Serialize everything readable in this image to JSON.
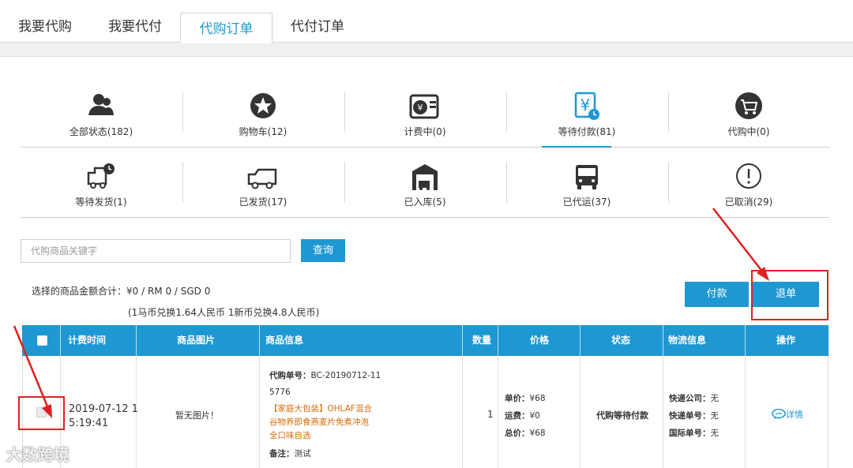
{
  "tabs": [
    "我要代购",
    "我要代付",
    "代购订单",
    "代付订单"
  ],
  "status_row1": [
    "全部状态(182)",
    "购物车(12)",
    "计费中(0)",
    "等待付款(81)",
    "代购中(0)"
  ],
  "status_row2": [
    "等待发货(1)",
    "已发货(17)",
    "已入库(5)",
    "已代运(37)",
    "已取消(29)"
  ],
  "search": {
    "placeholder": "代购商品关键字",
    "button": "查询"
  },
  "summary": {
    "total": "选择的商品金额合计：¥0  / RM 0  / SGD 0",
    "rate": "(1马币兑换1.64人民币 1新币兑换4.8人民币)"
  },
  "actions": {
    "pay": "付款",
    "refund": "退单"
  },
  "table": {
    "headers": [
      "计费时间",
      "商品图片",
      "商品信息",
      "数量",
      "价格",
      "状态",
      "物流信息",
      "操作"
    ],
    "row": {
      "time_line1": "2019-07-12 1",
      "time_line2": "5:19:41",
      "image": "暂无图片！",
      "order_no_label": "代购单号：",
      "order_no_line1": "BC-20190712-11",
      "order_no_line2": "5776",
      "product_line1": "【家庭大包装】OHLAF混合",
      "product_line2": "谷物养即食燕麦片免煮冲泡",
      "product_line3": "全口味自选",
      "note_label": "备注：",
      "note": "测试",
      "qty": "1",
      "unit_price_label": "单价：",
      "unit_price": "¥68",
      "shipping_label": "运费：",
      "shipping": "¥0",
      "total_label": "总价：",
      "total": "¥68",
      "status": "代购等待付款",
      "courier_label": "快递公司：",
      "courier": "无",
      "tracking_label": "快递单号：",
      "tracking": "无",
      "intl_label": "国际单号：",
      "intl": "无",
      "detail": "详情"
    }
  },
  "watermark": "大数跨境",
  "colors": {
    "accent": "#1d98d2",
    "annotation": "#e02020",
    "text": "#333333"
  },
  "icons": [
    "user-group-icon",
    "star-circle-icon",
    "yen-calculator-icon",
    "yen-clock-icon",
    "shopping-cart-icon",
    "truck-clock-icon",
    "truck-icon",
    "warehouse-icon",
    "bus-icon",
    "exclamation-circle-icon",
    "chat-bubble-icon",
    "checkbox-icon"
  ]
}
